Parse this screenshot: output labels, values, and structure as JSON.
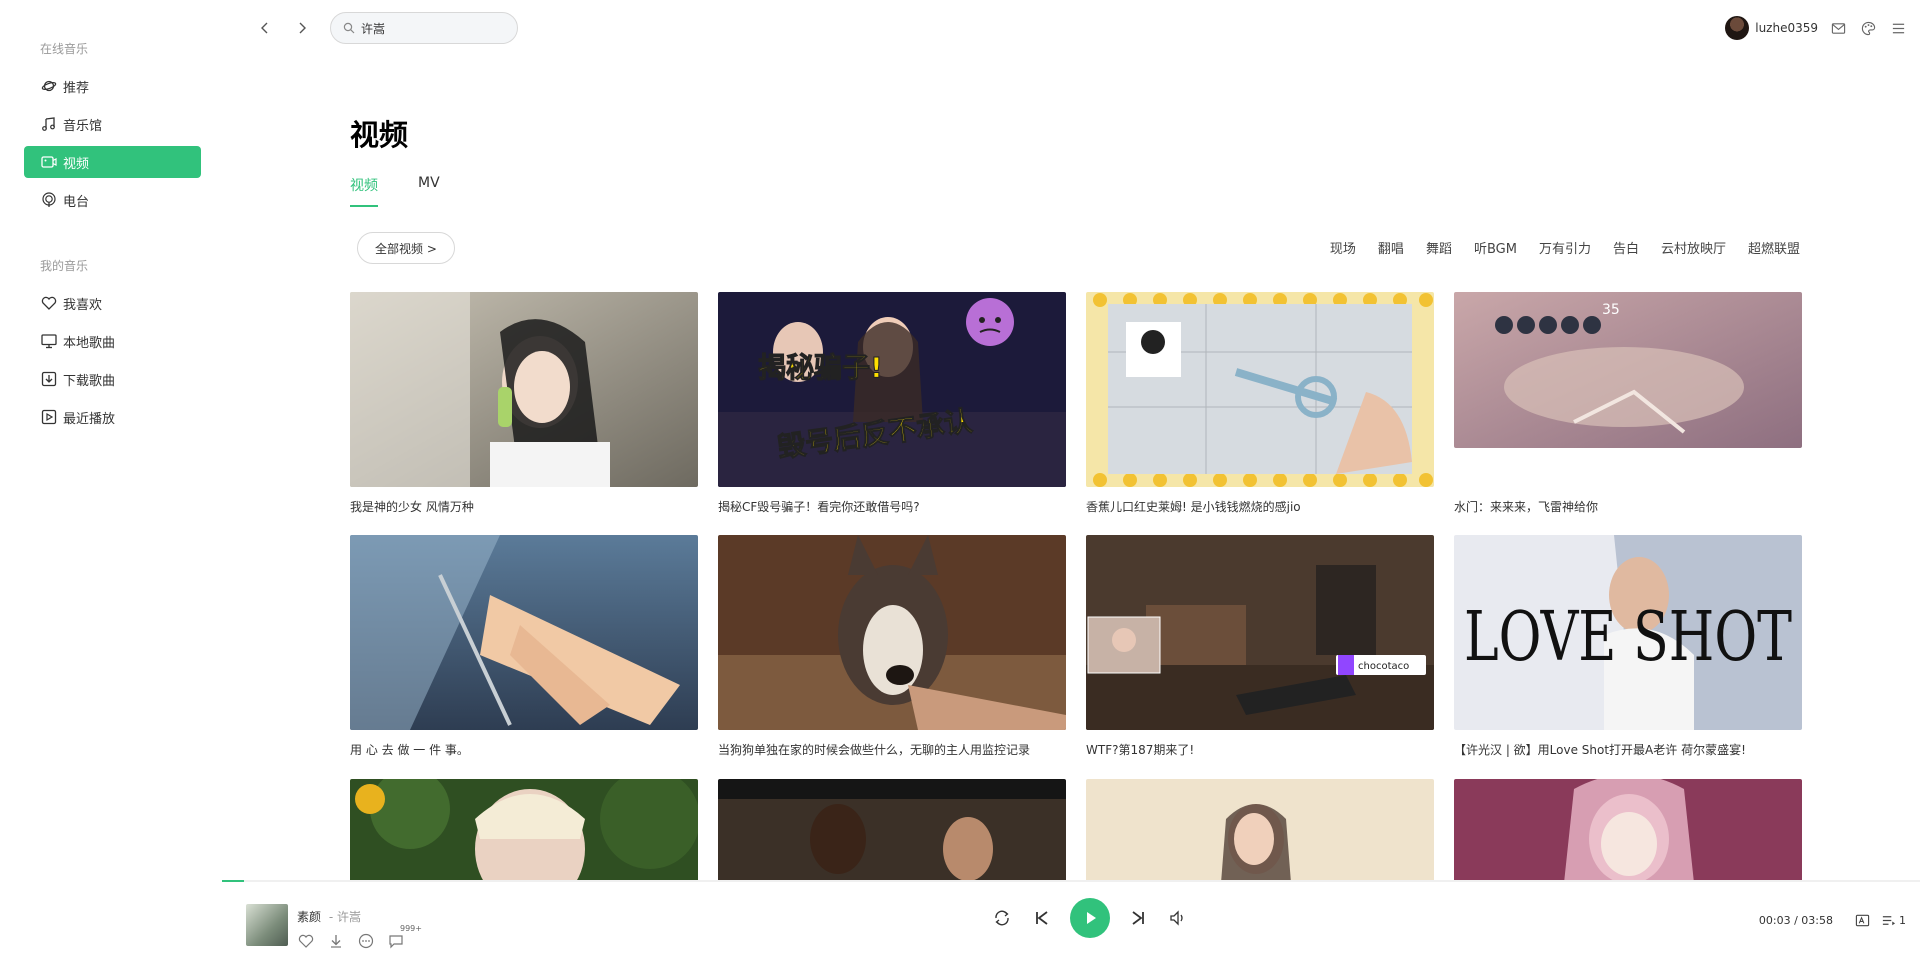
{
  "sidebar": {
    "section_online": "在线音乐",
    "online_items": [
      {
        "label": "推荐",
        "icon": "planet-icon"
      },
      {
        "label": "音乐馆",
        "icon": "music-note-icon"
      },
      {
        "label": "视频",
        "icon": "video-icon",
        "active": true
      },
      {
        "label": "电台",
        "icon": "radio-icon"
      }
    ],
    "section_mine": "我的音乐",
    "mine_items": [
      {
        "label": "我喜欢",
        "icon": "heart-icon"
      },
      {
        "label": "本地歌曲",
        "icon": "monitor-icon"
      },
      {
        "label": "下载歌曲",
        "icon": "download-icon"
      },
      {
        "label": "最近播放",
        "icon": "play-history-icon"
      }
    ]
  },
  "topbar": {
    "search_value": "许嵩",
    "username": "luzhe0359"
  },
  "main": {
    "title": "视频",
    "tabs": [
      {
        "label": "视频",
        "active": true
      },
      {
        "label": "MV",
        "active": false
      }
    ],
    "all_videos_label": "全部视频 >",
    "tags": [
      "现场",
      "翻唱",
      "舞蹈",
      "听BGM",
      "万有引力",
      "告白",
      "云村放映厅",
      "超燃联盟"
    ],
    "videos": [
      {
        "caption": "我是神的少女 风情万种"
      },
      {
        "caption": "揭秘CF毁号骗子！看完你还敢借号吗?"
      },
      {
        "caption": "香蕉儿口红史莱姆! 是小钱钱燃烧的感jio"
      },
      {
        "caption": "水门：来来来，飞雷神给你"
      },
      {
        "caption": "用 心 去 做 一 件 事。"
      },
      {
        "caption": "当狗狗单独在家的时候会做些什么，无聊的主人用监控记录"
      },
      {
        "caption": "WTF?第187期来了!"
      },
      {
        "caption": "【许光汉 | 欲】用Love Shot打开最A老许 荷尔蒙盛宴!"
      },
      {
        "caption": ""
      },
      {
        "caption": ""
      },
      {
        "caption": ""
      },
      {
        "caption": ""
      }
    ],
    "thumb_texts": {
      "cf_line1": "揭秘骗子!",
      "cf_line2": "毁号后反不承认",
      "love_shot": "LOVE SHOT",
      "chocotaco": "chocotaco",
      "score": "35"
    }
  },
  "player": {
    "song_title": "素颜",
    "song_artist": "- 许嵩",
    "comment_badge": "999+",
    "time": "00:03 / 03:58",
    "playlist_count": "1",
    "progress_percent": 1.3,
    "accent_color": "#31c27c"
  }
}
